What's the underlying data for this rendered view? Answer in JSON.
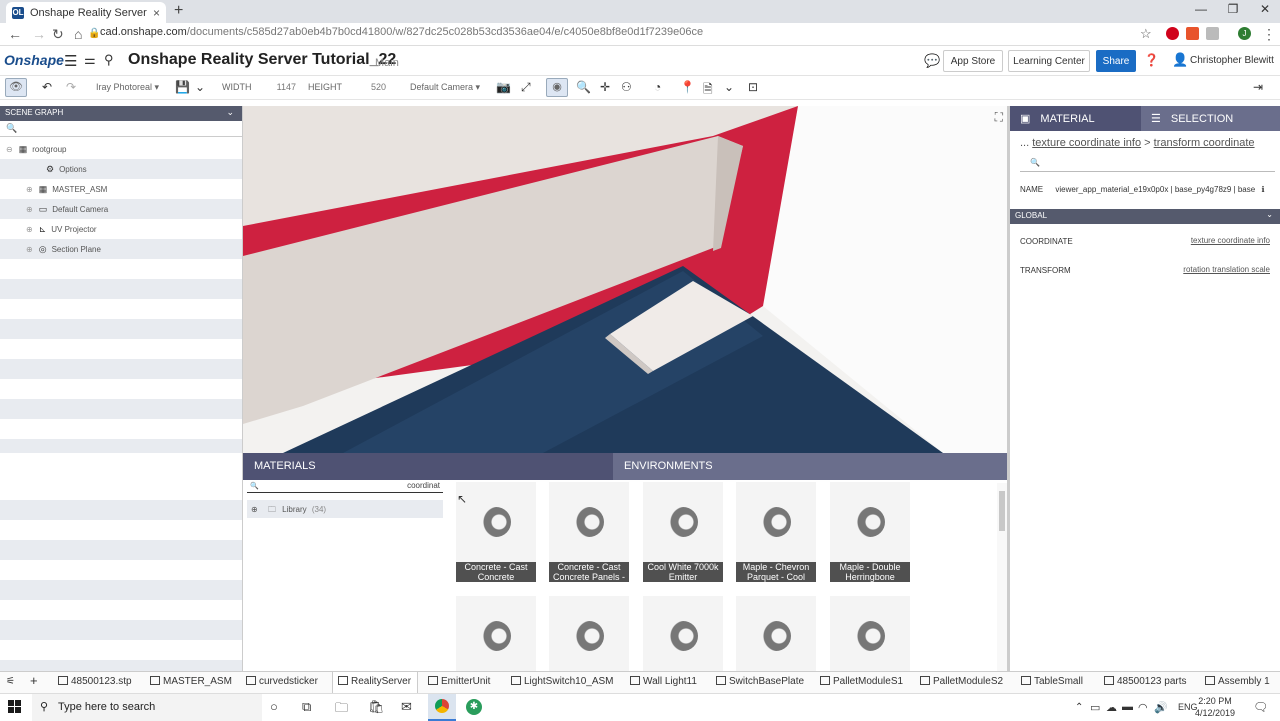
{
  "browser": {
    "tab_title": "Onshape Reality Server Tutorial_",
    "tab_favicon": "OL",
    "url_host": "cad.onshape.com",
    "url_path": "/documents/c585d27ab0eb4b7b0cd41800/w/827dc25c028b53cd3536ae04/e/c4050e8bf8e0d1f7239e06ce"
  },
  "header": {
    "logo": "Onshape",
    "doc_title": "Onshape Reality Server Tutorial_22",
    "branch": "Main",
    "app_store": "App Store",
    "learning_center": "Learning Center",
    "share": "Share",
    "user": "Christopher Blewitt"
  },
  "toolbar": {
    "render_mode": "Iray Photoreal",
    "width_label": "WIDTH",
    "width_value": "1147",
    "height_label": "HEIGHT",
    "height_value": "520",
    "camera": "Default Camera"
  },
  "scene_graph": {
    "title": "SCENE GRAPH",
    "items": [
      {
        "label": "rootgroup",
        "icon": "grid-icon"
      },
      {
        "label": "Options",
        "icon": "gear-icon"
      },
      {
        "label": "MASTER_ASM",
        "icon": "grid-icon"
      },
      {
        "label": "Default Camera",
        "icon": "camera-icon"
      },
      {
        "label": "UV Projector",
        "icon": "projector-icon"
      },
      {
        "label": "Section Plane",
        "icon": "section-plane-icon"
      }
    ]
  },
  "materials_panel": {
    "materials_tab": "MATERIALS",
    "environments_tab": "ENVIRONMENTS",
    "search_value": "coordinat",
    "library_label": "Library",
    "library_count": "(34)",
    "tiles": [
      "Concrete - Cast Concrete",
      "Concrete - Cast Concrete Panels -",
      "Cool White 7000k Emitter",
      "Maple - Chevron Parquet - Cool",
      "Maple - Double Herringbone",
      "",
      "",
      "",
      "",
      ""
    ]
  },
  "right_panel": {
    "tab_material": "MATERIAL",
    "tab_selection": "SELECTION",
    "crumb_prefix": "...",
    "crumb_1": "texture coordinate info",
    "crumb_sep": ">",
    "crumb_2": "transform coordinate",
    "name_label": "NAME",
    "name_value": "viewer_app_material_e19x0p0x | base_py4g78z9 | base",
    "global_title": "GLOBAL",
    "props": [
      {
        "name": "COORDINATE",
        "value": "texture coordinate info"
      },
      {
        "name": "TRANSFORM",
        "value": "rotation translation scale"
      }
    ]
  },
  "bottom_tabs": [
    "48500123.stp",
    "MASTER_ASM",
    "curvedsticker",
    "RealityServer",
    "EmitterUnit",
    "LightSwitch10_ASM",
    "Wall Light11",
    "SwitchBasePlate",
    "PalletModuleS1",
    "PalletModuleS2",
    "TableSmall",
    "48500123 parts",
    "Assembly 1"
  ],
  "taskbar": {
    "search_placeholder": "Type here to search",
    "lang": "ENG",
    "time": "2:20 PM",
    "date": "4/12/2019"
  },
  "colors": {
    "accent": "#1a6cc4",
    "panel_header": "#555a6d",
    "tab_active": "#4f5273",
    "tab_inactive": "#6a6e8c"
  }
}
